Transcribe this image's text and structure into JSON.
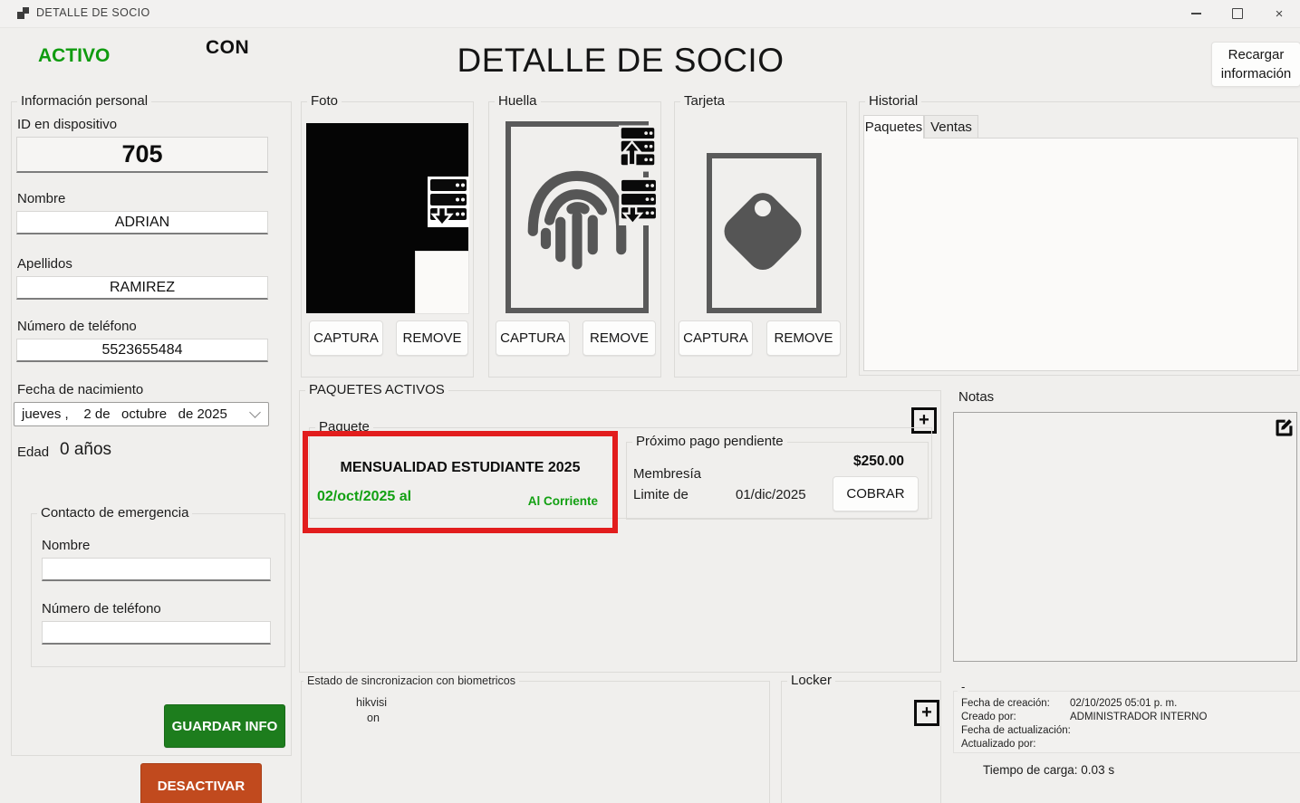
{
  "colors": {
    "active_green": "#0f9b0f",
    "save_green": "#1d7d1d",
    "deactivate_orange": "#c14a1e",
    "highlight_red": "#e21d1d",
    "status_green": "#12a012"
  },
  "window": {
    "title": "DETALLE DE SOCIO",
    "close_glyph": "×"
  },
  "header": {
    "status": "ACTIVO",
    "tag": "CON",
    "title": "DETALLE DE SOCIO",
    "reload_button": "Recargar información"
  },
  "personal_info": {
    "group_label": "Información personal",
    "device_id_label": "ID en dispositivo",
    "device_id": "705",
    "name_label": "Nombre",
    "name": "ADRIAN",
    "lastname_label": "Apellidos",
    "lastname": "RAMIREZ",
    "phone_label": "Número de teléfono",
    "phone": "5523655484",
    "birthdate_label": "Fecha de nacimiento",
    "birthdate": "jueves ,    2 de   octubre   de 2025",
    "age_label": "Edad",
    "age_value": "0 años",
    "emergency": {
      "group_label": "Contacto de emergencia",
      "name_label": "Nombre",
      "name": "",
      "phone_label": "Número de teléfono",
      "phone": ""
    },
    "save_button": "GUARDAR INFO",
    "deactivate_button": "DESACTIVAR"
  },
  "biometrics": {
    "photo": {
      "group_label": "Foto",
      "capture_button": "CAPTURA",
      "remove_button": "REMOVE"
    },
    "fingerprint": {
      "group_label": "Huella",
      "capture_button": "CAPTURA",
      "remove_button": "REMOVE"
    },
    "card": {
      "group_label": "Tarjeta",
      "capture_button": "CAPTURA",
      "remove_button": "REMOVE"
    }
  },
  "history": {
    "group_label": "Historial",
    "tabs": [
      {
        "label": "Paquetes",
        "active": true
      },
      {
        "label": "Ventas",
        "active": false
      }
    ]
  },
  "active_packages": {
    "group_label": "PAQUETES ACTIVOS",
    "add_glyph": "+",
    "package_group_label": "Paquete",
    "package_name": "MENSUALIDAD ESTUDIANTE 2025",
    "period": "02/oct/2025 al",
    "status": "Al Corriente",
    "next_payment": {
      "group_label": "Próximo pago pendiente",
      "membership_label": "Membresía",
      "limit_label": "Limite de",
      "limit_date": "01/dic/2025",
      "amount": "$250.00",
      "charge_button": "COBRAR"
    }
  },
  "notes": {
    "group_label": "Notas",
    "content": ""
  },
  "sync": {
    "group_label": "Estado de sincronizacion con biometricos",
    "line1": "hikvisi",
    "line2": "on"
  },
  "locker": {
    "group_label": "Locker",
    "add_glyph": "+"
  },
  "audit": {
    "group_label": "-",
    "created_label": "Fecha de creación:",
    "created_value": "02/10/2025 05:01 p. m.",
    "created_by_label": "Creado por:",
    "created_by_value": "ADMINISTRADOR INTERNO",
    "updated_label": "Fecha de actualización:",
    "updated_value": "",
    "updated_by_label": "Actualizado por:",
    "updated_by_value": ""
  },
  "footer": {
    "load_time": "Tiempo de carga: 0.03 s"
  }
}
